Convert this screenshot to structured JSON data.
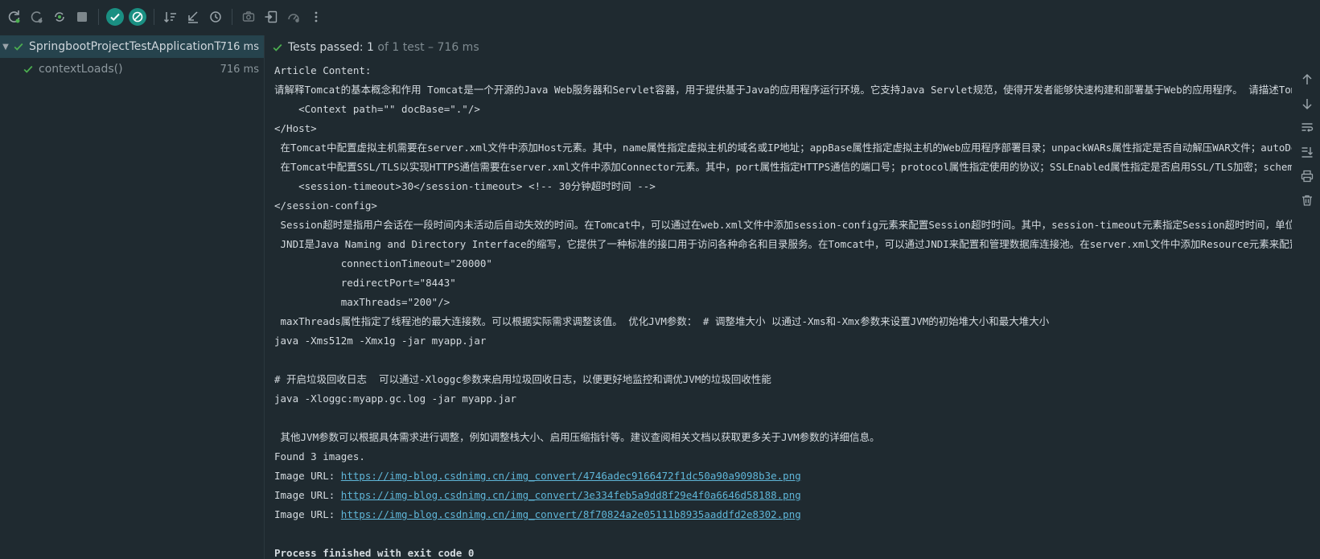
{
  "status": {
    "prefix": "Tests passed:",
    "count": "1",
    "suffix": "of 1 test – 716 ms"
  },
  "tree": [
    {
      "name": "SpringbootProjectTestApplicationTests",
      "time": "716 ms"
    },
    {
      "name": "contextLoads()",
      "time": "716 ms"
    }
  ],
  "console": {
    "lines": [
      "Article Content:",
      "请解释Tomcat的基本概念和作用 Tomcat是一个开源的Java Web服务器和Servlet容器，用于提供基于Java的应用程序运行环境。它支持Java Servlet规范，使得开发者能够快速构建和部署基于Web的应用程序。 请描述Tomcat的目",
      "    <Context path=\"\" docBase=\".\"/>",
      "</Host>",
      " 在Tomcat中配置虚拟主机需要在server.xml文件中添加Host元素。其中，name属性指定虚拟主机的域名或IP地址；appBase属性指定虚拟主机的Web应用程序部署目录；unpackWARs属性指定是否自动解压WAR文件；autoDeploy属性",
      " 在Tomcat中配置SSL/TLS以实现HTTPS通信需要在server.xml文件中添加Connector元素。其中，port属性指定HTTPS通信的端口号；protocol属性指定使用的协议；SSLEnabled属性指定是否启用SSL/TLS加密；scheme属性指定",
      "    <session-timeout>30</session-timeout> <!-- 30分钟超时时间 -->",
      "</session-config>",
      " Session超时是指用户会话在一段时间内未活动后自动失效的时间。在Tomcat中，可以通过在web.xml文件中添加session-config元素来配置Session超时时间。其中，session-timeout元素指定Session超时时间，单位为分钟。",
      " JNDI是Java Naming and Directory Interface的缩写，它提供了一种标准的接口用于访问各种命名和目录服务。在Tomcat中，可以通过JNDI来配置和管理数据库连接池。在server.xml文件中添加Resource元素来配置数据库连",
      "           connectionTimeout=\"20000\"",
      "           redirectPort=\"8443\"",
      "           maxThreads=\"200\"/>",
      " maxThreads属性指定了线程池的最大连接数。可以根据实际需求调整该值。 优化JVM参数： # 调整堆大小 以通过-Xms和-Xmx参数来设置JVM的初始堆大小和最大堆大小",
      "java -Xms512m -Xmx1g -jar myapp.jar",
      "",
      "# 开启垃圾回收日志  可以通过-Xloggc参数来启用垃圾回收日志，以便更好地监控和调优JVM的垃圾回收性能",
      "java -Xloggc:myapp.gc.log -jar myapp.jar",
      "",
      " 其他JVM参数可以根据具体需求进行调整，例如调整栈大小、启用压缩指针等。建议查阅相关文档以获取更多关于JVM参数的详细信息。",
      "Found 3 images."
    ],
    "image_label": "Image URL: ",
    "image_urls": [
      "https://img-blog.csdnimg.cn/img_convert/4746adec9166472f1dc50a90a9098b3e.png",
      "https://img-blog.csdnimg.cn/img_convert/3e334feb5a9dd8f29e4f0a6646d58188.png",
      "https://img-blog.csdnimg.cn/img_convert/8f70824a2e05111b8935aaddfd2e8302.png"
    ],
    "finish": "Process finished with exit code 0"
  },
  "colors": {
    "background": "#1f2a30",
    "selected_row": "#26434d",
    "pass_green": "#4caf50",
    "toggle_teal": "#1a8f82",
    "link": "#5fb6d8"
  },
  "icons": {
    "toolbar": [
      "rerun-icon",
      "rerun-failed-icon",
      "toggle-auto-test-icon",
      "stop-icon",
      "show-passed-icon",
      "show-ignored-icon",
      "sort-alphabetically-icon",
      "sort-by-duration-icon",
      "test-history-icon",
      "screenshot-icon",
      "import-tests-icon",
      "coverage-icon",
      "more-options-icon"
    ],
    "rightbar": [
      "up-arrow-icon",
      "down-arrow-icon",
      "soft-wrap-icon",
      "scroll-to-end-icon",
      "print-icon",
      "trash-icon"
    ]
  }
}
